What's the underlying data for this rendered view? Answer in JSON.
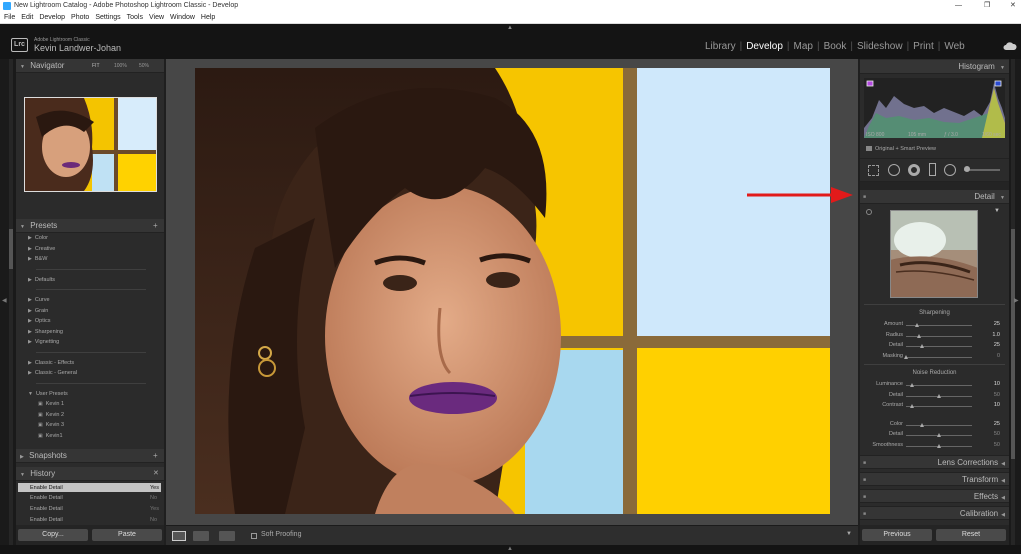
{
  "window": {
    "title": "New Lightroom Catalog - Adobe Photoshop Lightroom Classic - Develop",
    "controls": [
      "—",
      "❐",
      "✕"
    ]
  },
  "menu": [
    "File",
    "Edit",
    "Develop",
    "Photo",
    "Settings",
    "Tools",
    "View",
    "Window",
    "Help"
  ],
  "header": {
    "logo": "Lrc",
    "product": "Adobe Lightroom Classic",
    "user": "Kevin Landwer-Johan",
    "modules": [
      "Library",
      "Develop",
      "Map",
      "Book",
      "Slideshow",
      "Print",
      "Web"
    ],
    "active_module": "Develop"
  },
  "navigator": {
    "title": "Navigator",
    "zoom": [
      "FIT",
      "100%",
      "50%"
    ]
  },
  "presets": {
    "title": "Presets",
    "add": "+",
    "groups1": [
      "Color",
      "Creative",
      "B&W"
    ],
    "groups2": [
      "Defaults"
    ],
    "groups3": [
      "Curve",
      "Grain",
      "Optics",
      "Sharpening",
      "Vignetting"
    ],
    "groups4": [
      "Classic - Effects",
      "Classic - General"
    ],
    "user_group": "User Presets",
    "user_items": [
      "Kevin 1",
      "Kevin 2",
      "Kevin 3",
      "Kevin1"
    ]
  },
  "snapshots": {
    "title": "Snapshots",
    "add": "+"
  },
  "history": {
    "title": "History",
    "close": "✕",
    "items": [
      {
        "label": "Enable Detail",
        "value": "Yes"
      },
      {
        "label": "Enable Detail",
        "value": "No"
      },
      {
        "label": "Enable Detail",
        "value": "Yes"
      },
      {
        "label": "Enable Detail",
        "value": "No"
      }
    ]
  },
  "left_buttons": {
    "copy": "Copy...",
    "paste": "Paste"
  },
  "toolbar": {
    "soft_proofing": "Soft Proofing"
  },
  "histogram": {
    "title": "Histogram",
    "info": [
      "ISO 800",
      "105 mm",
      "ƒ / 3.0",
      "1/60 sec"
    ],
    "preview": "Original + Smart Preview"
  },
  "detail": {
    "title": "Detail",
    "sharpening": {
      "title": "Sharpening",
      "sliders": [
        {
          "label": "Amount",
          "value": "25",
          "pos": 0.17
        },
        {
          "label": "Radius",
          "value": "1.0",
          "pos": 0.2
        },
        {
          "label": "Detail",
          "value": "25",
          "pos": 0.25
        },
        {
          "label": "Masking",
          "value": "0",
          "pos": 0.0
        }
      ]
    },
    "noise": {
      "title": "Noise Reduction",
      "sliders": [
        {
          "label": "Luminance",
          "value": "10",
          "pos": 0.1
        },
        {
          "label": "Detail",
          "value": "50",
          "pos": 0.5
        },
        {
          "label": "Contrast",
          "value": "10",
          "pos": 0.1
        },
        {
          "label": "Color",
          "value": "25",
          "pos": 0.25
        },
        {
          "label": "Detail",
          "value": "50",
          "pos": 0.5
        },
        {
          "label": "Smoothness",
          "value": "50",
          "pos": 0.5
        }
      ]
    }
  },
  "right_sections": [
    "Lens Corrections",
    "Transform",
    "Effects",
    "Calibration"
  ],
  "right_buttons": {
    "previous": "Previous",
    "reset": "Reset"
  },
  "colors": {
    "accent_arrow": "#e21a1a",
    "panel": "#2b2b2b",
    "active_module": "#ffffff"
  }
}
